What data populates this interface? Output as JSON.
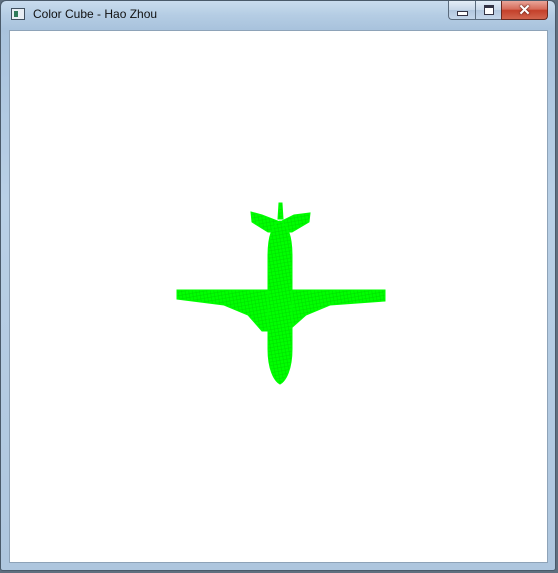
{
  "window": {
    "title": "Color Cube - Hao Zhou"
  },
  "controls": {
    "minimize_icon": "minimize-icon",
    "maximize_icon": "maximize-icon",
    "close_icon": "close-icon",
    "close_glyph": "✕"
  },
  "viewport": {
    "model": "airplane",
    "render_mode": "wireframe",
    "model_color": "#00ff00",
    "background_color": "#ffffff"
  }
}
